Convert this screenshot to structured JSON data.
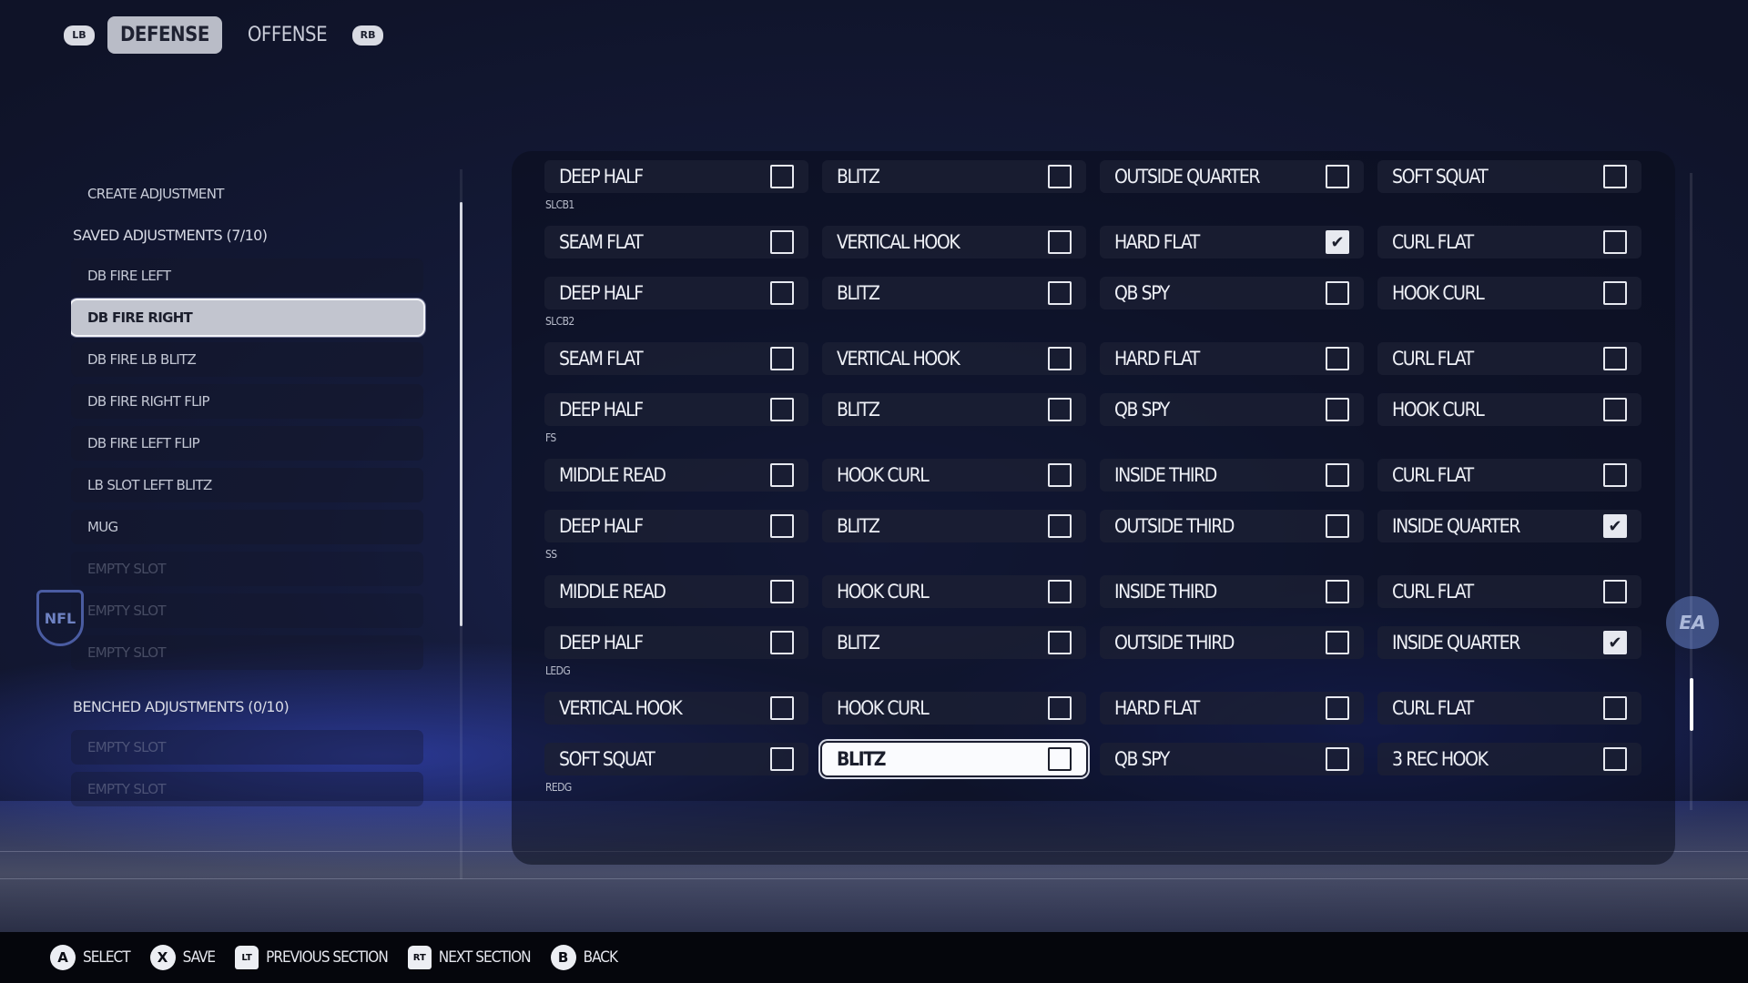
{
  "top_tabs": {
    "left_bumper": "LB",
    "right_bumper": "RB",
    "tabs": [
      {
        "label": "DEFENSE",
        "active": true
      },
      {
        "label": "OFFENSE",
        "active": false
      }
    ]
  },
  "left_list": {
    "create_label": "CREATE ADJUSTMENT",
    "saved_header": "SAVED ADJUSTMENTS (7/10)",
    "saved_items": [
      "DB FIRE LEFT",
      "DB FIRE RIGHT",
      "DB FIRE LB BLITZ",
      "DB FIRE RIGHT FLIP",
      "DB FIRE LEFT FLIP",
      "LB SLOT LEFT BLITZ",
      "MUG"
    ],
    "selected_item": "DB FIRE RIGHT",
    "saved_empty": [
      "EMPTY SLOT",
      "EMPTY SLOT",
      "EMPTY SLOT"
    ],
    "benched_header": "BENCHED ADJUSTMENTS (0/10)",
    "benched_empty": [
      "EMPTY SLOT",
      "EMPTY SLOT"
    ]
  },
  "grid": {
    "rows": [
      {
        "cells": [
          {
            "label": "DEEP HALF",
            "checked": false
          },
          {
            "label": "BLITZ",
            "checked": false
          },
          {
            "label": "OUTSIDE QUARTER",
            "checked": false
          },
          {
            "label": "SOFT SQUAT",
            "checked": false
          }
        ]
      },
      {
        "section": "SLCB1"
      },
      {
        "cells": [
          {
            "label": "SEAM FLAT",
            "checked": false
          },
          {
            "label": "VERTICAL HOOK",
            "checked": false
          },
          {
            "label": "HARD FLAT",
            "checked": true
          },
          {
            "label": "CURL FLAT",
            "checked": false
          }
        ]
      },
      {
        "cells": [
          {
            "label": "DEEP HALF",
            "checked": false
          },
          {
            "label": "BLITZ",
            "checked": false
          },
          {
            "label": "QB SPY",
            "checked": false
          },
          {
            "label": "HOOK CURL",
            "checked": false
          }
        ]
      },
      {
        "section": "SLCB2"
      },
      {
        "cells": [
          {
            "label": "SEAM FLAT",
            "checked": false
          },
          {
            "label": "VERTICAL HOOK",
            "checked": false
          },
          {
            "label": "HARD FLAT",
            "checked": false
          },
          {
            "label": "CURL FLAT",
            "checked": false
          }
        ]
      },
      {
        "cells": [
          {
            "label": "DEEP HALF",
            "checked": false
          },
          {
            "label": "BLITZ",
            "checked": false
          },
          {
            "label": "QB SPY",
            "checked": false
          },
          {
            "label": "HOOK CURL",
            "checked": false
          }
        ]
      },
      {
        "section": "FS"
      },
      {
        "cells": [
          {
            "label": "MIDDLE READ",
            "checked": false
          },
          {
            "label": "HOOK CURL",
            "checked": false
          },
          {
            "label": "INSIDE THIRD",
            "checked": false
          },
          {
            "label": "CURL FLAT",
            "checked": false
          }
        ]
      },
      {
        "cells": [
          {
            "label": "DEEP HALF",
            "checked": false
          },
          {
            "label": "BLITZ",
            "checked": false
          },
          {
            "label": "OUTSIDE THIRD",
            "checked": false
          },
          {
            "label": "INSIDE QUARTER",
            "checked": true
          }
        ]
      },
      {
        "section": "SS"
      },
      {
        "cells": [
          {
            "label": "MIDDLE READ",
            "checked": false
          },
          {
            "label": "HOOK CURL",
            "checked": false
          },
          {
            "label": "INSIDE THIRD",
            "checked": false
          },
          {
            "label": "CURL FLAT",
            "checked": false
          }
        ]
      },
      {
        "cells": [
          {
            "label": "DEEP HALF",
            "checked": false
          },
          {
            "label": "BLITZ",
            "checked": false
          },
          {
            "label": "OUTSIDE THIRD",
            "checked": false
          },
          {
            "label": "INSIDE QUARTER",
            "checked": true
          }
        ]
      },
      {
        "section": "LEDG"
      },
      {
        "cells": [
          {
            "label": "VERTICAL HOOK",
            "checked": false
          },
          {
            "label": "HOOK CURL",
            "checked": false
          },
          {
            "label": "HARD FLAT",
            "checked": false
          },
          {
            "label": "CURL FLAT",
            "checked": false
          }
        ]
      },
      {
        "cells": [
          {
            "label": "SOFT SQUAT",
            "checked": false
          },
          {
            "label": "BLITZ",
            "checked": false,
            "focused": true
          },
          {
            "label": "QB SPY",
            "checked": false
          },
          {
            "label": "3 REC HOOK",
            "checked": false
          }
        ]
      },
      {
        "section": "REDG"
      }
    ]
  },
  "logos": {
    "nfl": "NFL",
    "ea": "EA"
  },
  "bottom_bar": {
    "hints": [
      {
        "button": "A",
        "kind": "round",
        "label": "SELECT"
      },
      {
        "button": "X",
        "kind": "round",
        "label": "SAVE"
      },
      {
        "button": "LT",
        "kind": "trigger",
        "label": "PREVIOUS SECTION"
      },
      {
        "button": "RT",
        "kind": "trigger",
        "label": "NEXT SECTION"
      },
      {
        "button": "B",
        "kind": "round",
        "label": "BACK"
      }
    ]
  },
  "colors": {
    "accent": "#c2c5cf",
    "background": "#141a38",
    "check_fill": "#e7e9f0"
  }
}
